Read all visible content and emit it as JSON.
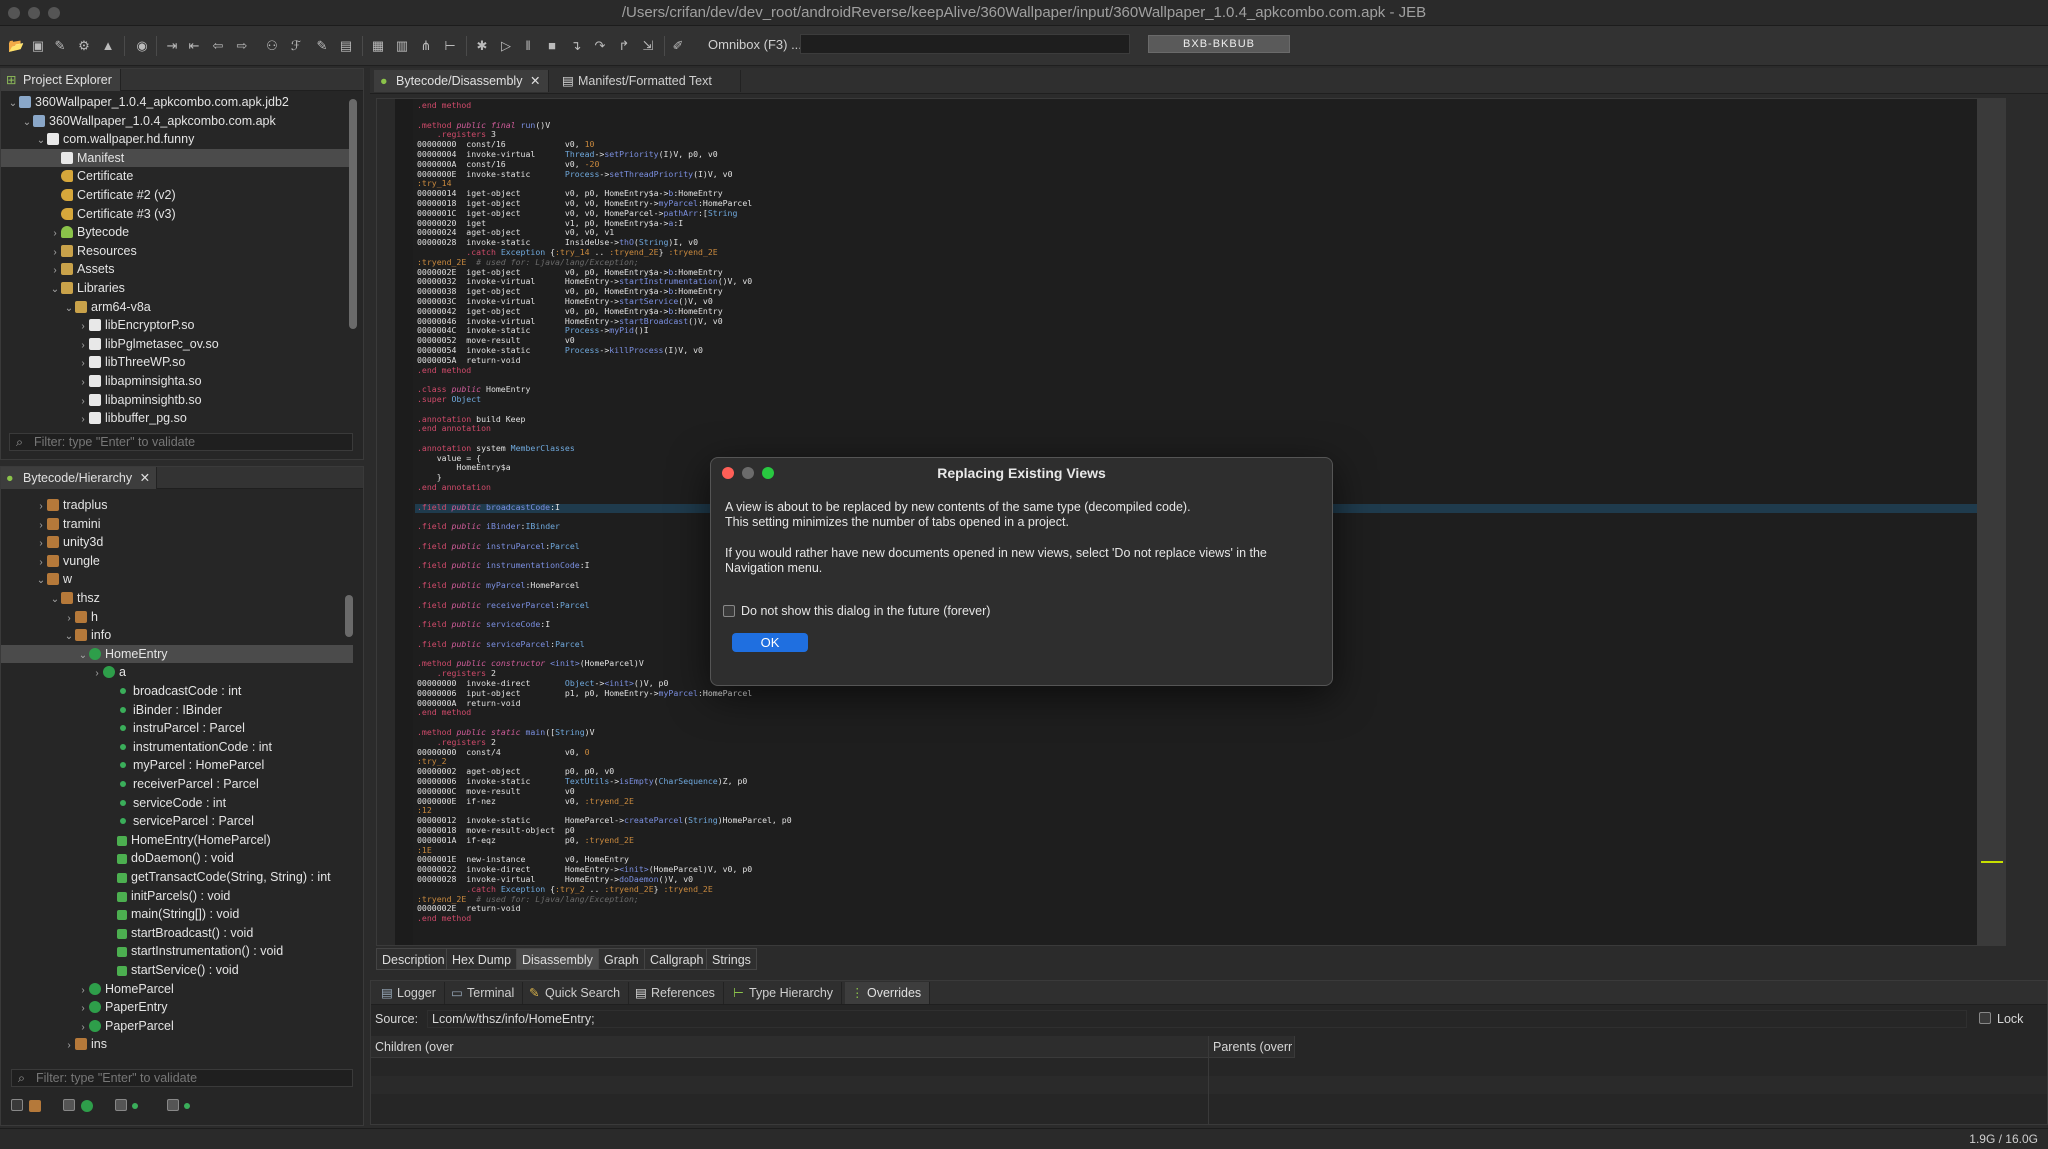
{
  "window": {
    "title": "/Users/crifan/dev/dev_root/androidReverse/keepAlive/360Wallpaper/input/360Wallpaper_1.0.4_apkcombo.com.apk - JEB"
  },
  "toolbar": {
    "omnibox_label": "Omnibox (F3) ...",
    "heap_button": "BXB-BKBUB"
  },
  "project_explorer": {
    "tab_label": "Project Explorer",
    "items": [
      {
        "label": "360Wallpaper_1.0.4_apkcombo.com.apk.jdb2",
        "indent": 0,
        "icon": "jdb",
        "expanded": true
      },
      {
        "label": "360Wallpaper_1.0.4_apkcombo.com.apk",
        "indent": 1,
        "icon": "globe",
        "expanded": true
      },
      {
        "label": "com.wallpaper.hd.funny",
        "indent": 2,
        "icon": "file",
        "expanded": true
      },
      {
        "label": "Manifest",
        "indent": 3,
        "icon": "file",
        "selected": true
      },
      {
        "label": "Certificate",
        "indent": 3,
        "icon": "cert"
      },
      {
        "label": "Certificate #2 (v2)",
        "indent": 3,
        "icon": "cert"
      },
      {
        "label": "Certificate #3 (v3)",
        "indent": 3,
        "icon": "cert"
      },
      {
        "label": "Bytecode",
        "indent": 3,
        "icon": "android",
        "collapsed": true
      },
      {
        "label": "Resources",
        "indent": 3,
        "icon": "folder",
        "collapsed": true
      },
      {
        "label": "Assets",
        "indent": 3,
        "icon": "folder",
        "collapsed": true
      },
      {
        "label": "Libraries",
        "indent": 3,
        "icon": "folder",
        "expanded": true
      },
      {
        "label": "arm64-v8a",
        "indent": 4,
        "icon": "folder",
        "expanded": true
      },
      {
        "label": "libEncryptorP.so",
        "indent": 5,
        "icon": "file",
        "collapsed": true
      },
      {
        "label": "libPglmetasec_ov.so",
        "indent": 5,
        "icon": "file",
        "collapsed": true
      },
      {
        "label": "libThreeWP.so",
        "indent": 5,
        "icon": "file",
        "collapsed": true
      },
      {
        "label": "libapminsighta.so",
        "indent": 5,
        "icon": "file",
        "collapsed": true
      },
      {
        "label": "libapminsightb.so",
        "indent": 5,
        "icon": "file",
        "collapsed": true
      },
      {
        "label": "libbuffer_pg.so",
        "indent": 5,
        "icon": "file",
        "collapsed": true
      }
    ],
    "filter_placeholder": "Filter: type \"Enter\" to validate"
  },
  "hierarchy": {
    "tab_label": "Bytecode/Hierarchy",
    "items": [
      {
        "label": "tradplus",
        "indent": 2,
        "icon": "pkg",
        "collapsed": true
      },
      {
        "label": "tramini",
        "indent": 2,
        "icon": "pkg",
        "collapsed": true
      },
      {
        "label": "unity3d",
        "indent": 2,
        "icon": "pkg",
        "collapsed": true
      },
      {
        "label": "vungle",
        "indent": 2,
        "icon": "pkg",
        "collapsed": true
      },
      {
        "label": "w",
        "indent": 2,
        "icon": "pkg",
        "expanded": true
      },
      {
        "label": "thsz",
        "indent": 3,
        "icon": "pkg",
        "expanded": true
      },
      {
        "label": "h",
        "indent": 4,
        "icon": "pkg",
        "collapsed": true
      },
      {
        "label": "info",
        "indent": 4,
        "icon": "pkg",
        "expanded": true
      },
      {
        "label": "HomeEntry",
        "indent": 5,
        "icon": "cls",
        "expanded": true,
        "selected": true
      },
      {
        "label": "a",
        "indent": 6,
        "icon": "cls",
        "collapsed": true
      },
      {
        "label": "broadcastCode : int",
        "indent": 7,
        "icon": "fld"
      },
      {
        "label": "iBinder : IBinder",
        "indent": 7,
        "icon": "fld"
      },
      {
        "label": "instruParcel : Parcel",
        "indent": 7,
        "icon": "fld"
      },
      {
        "label": "instrumentationCode : int",
        "indent": 7,
        "icon": "fld"
      },
      {
        "label": "myParcel : HomeParcel",
        "indent": 7,
        "icon": "fld"
      },
      {
        "label": "receiverParcel : Parcel",
        "indent": 7,
        "icon": "fld"
      },
      {
        "label": "serviceCode : int",
        "indent": 7,
        "icon": "fld"
      },
      {
        "label": "serviceParcel : Parcel",
        "indent": 7,
        "icon": "fld"
      },
      {
        "label": "HomeEntry(HomeParcel)",
        "indent": 7,
        "icon": "mth"
      },
      {
        "label": "doDaemon() : void",
        "indent": 7,
        "icon": "mth"
      },
      {
        "label": "getTransactCode(String, String) : int",
        "indent": 7,
        "icon": "mth"
      },
      {
        "label": "initParcels() : void",
        "indent": 7,
        "icon": "mth"
      },
      {
        "label": "main(String[]) : void",
        "indent": 7,
        "icon": "mth"
      },
      {
        "label": "startBroadcast() : void",
        "indent": 7,
        "icon": "mth"
      },
      {
        "label": "startInstrumentation() : void",
        "indent": 7,
        "icon": "mth"
      },
      {
        "label": "startService() : void",
        "indent": 7,
        "icon": "mth"
      },
      {
        "label": "HomeParcel",
        "indent": 5,
        "icon": "cls",
        "collapsed": true
      },
      {
        "label": "PaperEntry",
        "indent": 5,
        "icon": "cls",
        "collapsed": true
      },
      {
        "label": "PaperParcel",
        "indent": 5,
        "icon": "cls",
        "collapsed": true
      },
      {
        "label": "ins",
        "indent": 4,
        "icon": "pkg",
        "collapsed": true
      }
    ],
    "filter_placeholder": "Filter: type \"Enter\" to validate"
  },
  "editor": {
    "tabs": [
      {
        "label": "Bytecode/Disassembly",
        "active": true
      },
      {
        "label": "Manifest/Formatted Text",
        "active": false
      }
    ],
    "bottom_tabs": [
      "Description",
      "Hex Dump",
      "Disassembly",
      "Graph",
      "Callgraph",
      "Strings"
    ],
    "active_bottom_tab": "Disassembly"
  },
  "lower_panel": {
    "tabs": [
      "Logger",
      "Terminal",
      "Quick Search",
      "References",
      "Type Hierarchy",
      "Overrides"
    ],
    "active_tab": "Overrides",
    "source_label": "Source:",
    "source_value": "Lcom/w/thsz/info/HomeEntry;",
    "lock_label": "Lock",
    "children_header": "Children (over",
    "parents_header": "Parents (overr"
  },
  "status": {
    "memory": "1.9G / 16.0G"
  },
  "dialog": {
    "title": "Replacing Existing Views",
    "line1": "A view is about to be replaced by new contents of the same type (decompiled code).",
    "line2": "This setting minimizes the number of tabs opened in a project.",
    "line3": "If you would rather have new documents opened in new views, select 'Do not replace views' in the",
    "line4": "Navigation menu.",
    "checkbox_label": "Do not show this dialog in the future (forever)",
    "ok_label": "OK"
  },
  "colors": {
    "accent": "#1f6fe0",
    "selection": "#4b4b4b",
    "close_red": "#ff5f57",
    "minimize_yellow": "#febc2e",
    "zoom_green": "#28c840"
  }
}
